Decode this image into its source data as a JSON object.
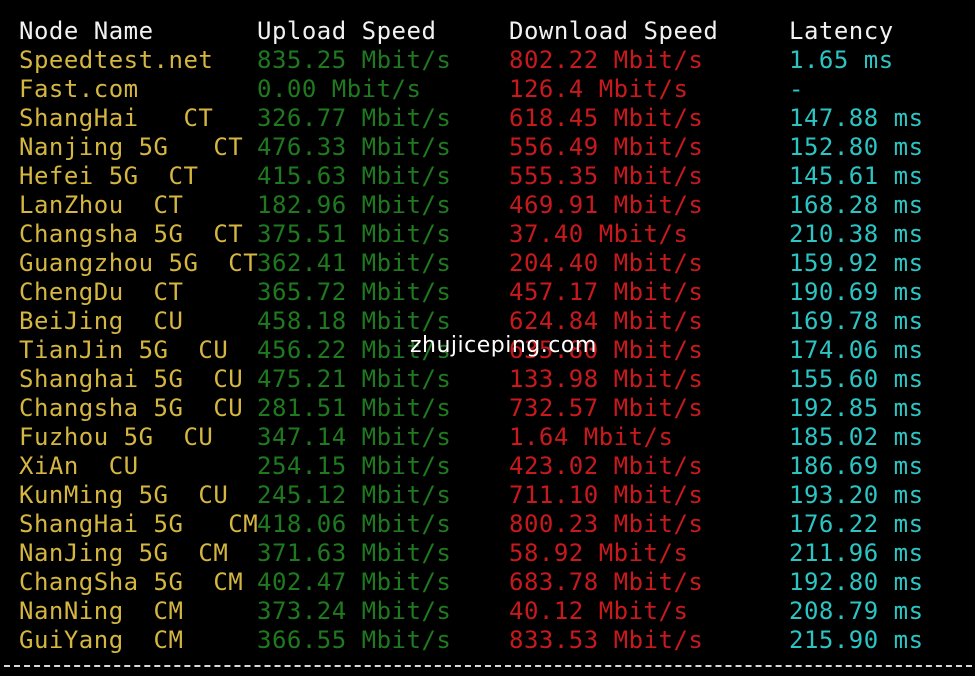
{
  "colors": {
    "background": "#000000",
    "header": "#f2f2f2",
    "node": "#d4b640",
    "upload": "#1f7a1f",
    "download": "#c8191d",
    "latency": "#2dc4c4"
  },
  "headers": {
    "node": "Node Name",
    "upload": "Upload Speed",
    "download": "Download Speed",
    "latency": "Latency"
  },
  "rows": [
    {
      "node": "Speedtest.net",
      "upload": "835.25 Mbit/s",
      "download": "802.22 Mbit/s",
      "latency": "1.65 ms"
    },
    {
      "node": "Fast.com",
      "upload": "0.00 Mbit/s",
      "download": "126.4 Mbit/s",
      "latency": "-"
    },
    {
      "node": "ShangHai   CT",
      "upload": "326.77 Mbit/s",
      "download": "618.45 Mbit/s",
      "latency": "147.88 ms"
    },
    {
      "node": "Nanjing 5G   CT",
      "upload": "476.33 Mbit/s",
      "download": "556.49 Mbit/s",
      "latency": "152.80 ms"
    },
    {
      "node": "Hefei 5G  CT",
      "upload": "415.63 Mbit/s",
      "download": "555.35 Mbit/s",
      "latency": "145.61 ms"
    },
    {
      "node": "LanZhou  CT",
      "upload": "182.96 Mbit/s",
      "download": "469.91 Mbit/s",
      "latency": "168.28 ms"
    },
    {
      "node": "Changsha 5G  CT",
      "upload": "375.51 Mbit/s",
      "download": "37.40 Mbit/s",
      "latency": "210.38 ms"
    },
    {
      "node": "Guangzhou 5G  CT",
      "upload": "362.41 Mbit/s",
      "download": "204.40 Mbit/s",
      "latency": "159.92 ms"
    },
    {
      "node": "ChengDu  CT",
      "upload": "365.72 Mbit/s",
      "download": "457.17 Mbit/s",
      "latency": "190.69 ms"
    },
    {
      "node": "BeiJing  CU",
      "upload": "458.18 Mbit/s",
      "download": "624.84 Mbit/s",
      "latency": "169.78 ms"
    },
    {
      "node": "TianJin 5G  CU",
      "upload": "456.22 Mbit/s",
      "download": "635.80 Mbit/s",
      "latency": "174.06 ms"
    },
    {
      "node": "Shanghai 5G  CU",
      "upload": "475.21 Mbit/s",
      "download": "133.98 Mbit/s",
      "latency": "155.60 ms"
    },
    {
      "node": "Changsha 5G  CU",
      "upload": "281.51 Mbit/s",
      "download": "732.57 Mbit/s",
      "latency": "192.85 ms"
    },
    {
      "node": "Fuzhou 5G  CU",
      "upload": "347.14 Mbit/s",
      "download": "1.64 Mbit/s",
      "latency": "185.02 ms"
    },
    {
      "node": "XiAn  CU",
      "upload": "254.15 Mbit/s",
      "download": "423.02 Mbit/s",
      "latency": "186.69 ms"
    },
    {
      "node": "KunMing 5G  CU",
      "upload": "245.12 Mbit/s",
      "download": "711.10 Mbit/s",
      "latency": "193.20 ms"
    },
    {
      "node": "ShangHai 5G   CM",
      "upload": "418.06 Mbit/s",
      "download": "800.23 Mbit/s",
      "latency": "176.22 ms"
    },
    {
      "node": "NanJing 5G  CM",
      "upload": "371.63 Mbit/s",
      "download": "58.92 Mbit/s",
      "latency": "211.96 ms"
    },
    {
      "node": "ChangSha 5G  CM",
      "upload": "402.47 Mbit/s",
      "download": "683.78 Mbit/s",
      "latency": "192.80 ms"
    },
    {
      "node": "NanNing  CM",
      "upload": "373.24 Mbit/s",
      "download": "40.12 Mbit/s",
      "latency": "208.79 ms"
    },
    {
      "node": "GuiYang  CM",
      "upload": "366.55 Mbit/s",
      "download": "833.53 Mbit/s",
      "latency": "215.90 ms"
    }
  ],
  "watermark": "zhujiceping.com"
}
